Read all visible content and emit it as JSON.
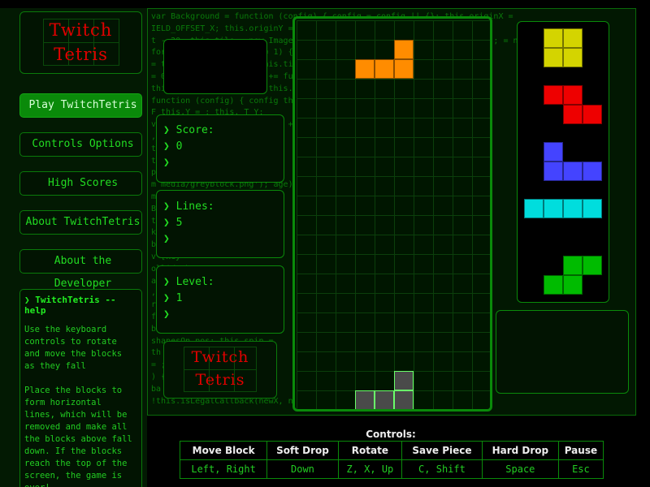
{
  "logo": {
    "line1": "Twitch",
    "line2": "Tetris"
  },
  "menu": [
    {
      "label": "Play TwitchTetris",
      "active": true
    },
    {
      "label": "Controls Options",
      "active": false
    },
    {
      "label": "High Scores",
      "active": false
    },
    {
      "label": "About TwitchTetris",
      "active": false
    },
    {
      "label": "About the Developer",
      "active": false
    }
  ],
  "help": {
    "title": "❯ TwitchTetris --help",
    "p1": "Use the keyboard controls to rotate and move the blocks as they fall",
    "p2": "Place the blocks to form horizontal lines, which will be removed and make all the blocks above fall down. If the blocks reach the top of the screen, the game is over!"
  },
  "stats": {
    "score_label": "❯ Score:",
    "score_value": "❯ 0",
    "lines_label": "❯ Lines:",
    "lines_value": "❯ 5",
    "level_label": "❯ Level:",
    "level_value": "❯ 1",
    "prompt": "❯"
  },
  "code_lines": [
    "var Background = function (config) {    config = config || {};    this.originX =",
    "IELD_OFFSET_X;    this.originY = PIECE_SIZE;                    this.",
    "t - 20;    this.tile = new Image();   this.tile.src = 'media/greyblock.png';  = new",
    "  for (i = 0; i < 10; i += 1) {   'media/b  op.x   this.tiles.push(   op.y",
    "  =   this.prototype.draw   this.tile.onload  backgroundTile  (i",
    "  = 0; i < BOARD_WIDTH; i +=   function () {     ++) {   x =",
    "   this.tile.draw();  WIDTH    this.y    + BL",
    "function (config) {    config   this.boardOr  _WID",
    "F   this.Y = ;   this.  T_Y;",
    "   var BLOCK_SIZE   this.xOffset   + BLO  kX;",
    " ,       this.preview   view)",
    "        this.  this.shape    shape",
    "           this.  [key  ));",
    "p   this.blocks   {",
    "m  media/greyblock.png');   age);  pe.",
    "m   this.type   dy;",
    "B   this.   on =  ockY",
    "    this.   .boX  DTH;",
    "   k   funct",
    "b   nctio",
    "v   [key",
    "   ollid  The",
    "     ay of",
    "   , 1,",
    "   rn t  be",
    "f   is the",
    "    bleft",
    "    shapesOn.pos;   this.spin =",
    "    th   ICK",
    " =  ;   ;",
    "    ) {",
    "    ba   //",
    "!this.isLegalCallback(newX, n   )   this.b"
  ],
  "board": {
    "cols": 10,
    "rows": 20,
    "active_piece": {
      "type": "L",
      "color": "#ff8c00",
      "cells": [
        [
          5,
          1
        ],
        [
          3,
          2
        ],
        [
          4,
          2
        ],
        [
          5,
          2
        ]
      ]
    },
    "ghost_piece": {
      "type": "L",
      "color": "#4a4a4a",
      "cells": [
        [
          5,
          18
        ],
        [
          3,
          19
        ],
        [
          4,
          19
        ],
        [
          5,
          19
        ]
      ]
    }
  },
  "next_queue": [
    {
      "type": "O",
      "color": "#d4d400",
      "cells": [
        [
          1,
          0
        ],
        [
          2,
          0
        ],
        [
          1,
          1
        ],
        [
          2,
          1
        ]
      ]
    },
    {
      "type": "Z",
      "color": "#ee0000",
      "cells": [
        [
          1,
          0
        ],
        [
          2,
          0
        ],
        [
          2,
          1
        ],
        [
          3,
          1
        ]
      ]
    },
    {
      "type": "J",
      "color": "#4444ff",
      "cells": [
        [
          1,
          0
        ],
        [
          1,
          1
        ],
        [
          2,
          1
        ],
        [
          3,
          1
        ]
      ]
    },
    {
      "type": "I",
      "color": "#00dddd",
      "cells": [
        [
          0,
          0
        ],
        [
          1,
          0
        ],
        [
          2,
          0
        ],
        [
          3,
          0
        ]
      ]
    },
    {
      "type": "S",
      "color": "#00bb00",
      "cells": [
        [
          2,
          0
        ],
        [
          3,
          0
        ],
        [
          1,
          1
        ],
        [
          2,
          1
        ]
      ]
    }
  ],
  "controls": {
    "title": "Controls:",
    "headers": [
      "Move Block",
      "Soft Drop",
      "Rotate",
      "Save Piece",
      "Hard Drop",
      "Pause"
    ],
    "keys": [
      "Left, Right",
      "Down",
      "Z, X, Up",
      "C, Shift",
      "Space",
      "Esc"
    ]
  }
}
